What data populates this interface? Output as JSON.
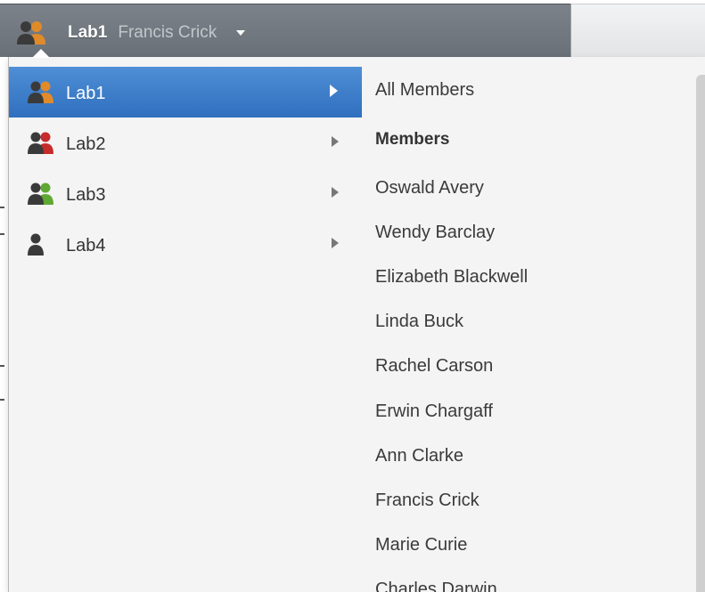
{
  "header": {
    "current_group": "Lab1",
    "current_user": "Francis Crick",
    "group_icon": "group-users-icon",
    "caret_icon": "caret-down-icon"
  },
  "groups": [
    {
      "label": "Lab1",
      "active": true,
      "icon_colors": [
        "#3a3a3a",
        "#e08b2a"
      ]
    },
    {
      "label": "Lab2",
      "active": false,
      "icon_colors": [
        "#3a3a3a",
        "#c62a2a"
      ]
    },
    {
      "label": "Lab3",
      "active": false,
      "icon_colors": [
        "#3a3a3a",
        "#5fa832"
      ]
    },
    {
      "label": "Lab4",
      "active": false,
      "icon_colors": [
        "#3a3a3a"
      ]
    }
  ],
  "members_menu": {
    "all_members": "All Members",
    "section_header": "Members",
    "members": [
      "Oswald Avery",
      "Wendy Barclay",
      "Elizabeth Blackwell",
      "Linda Buck",
      "Rachel Carson",
      "Erwin Chargaff",
      "Ann Clarke",
      "Francis Crick",
      "Marie Curie",
      "Charles Darwin"
    ]
  },
  "colors": {
    "active_highlight": "#3b7cc9",
    "topbar": "#737980",
    "menu_bg": "#f4f4f4"
  }
}
